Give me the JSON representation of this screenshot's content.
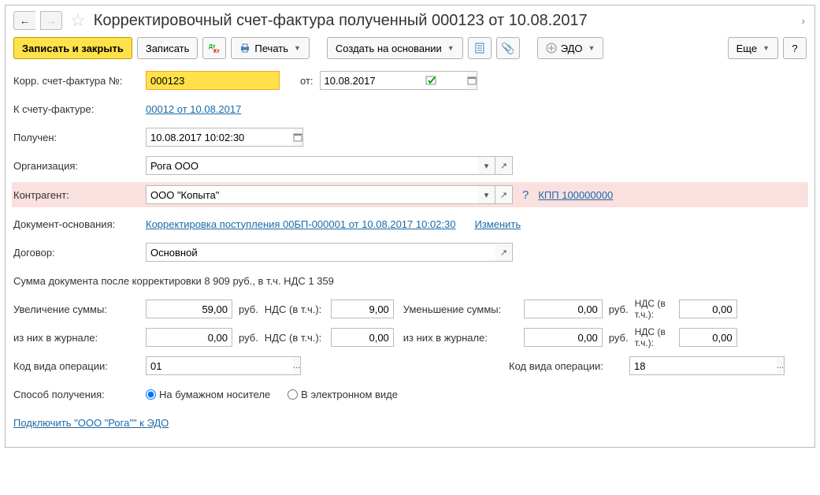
{
  "title": "Корректировочный счет-фактура полученный 000123 от 10.08.2017",
  "toolbar": {
    "save_close": "Записать и закрыть",
    "save": "Записать",
    "print": "Печать",
    "create_based": "Создать на основании",
    "edo": "ЭДО",
    "more": "Еще",
    "help": "?"
  },
  "fields": {
    "number_label": "Корр. счет-фактура №:",
    "number_value": "000123",
    "from_label": "от:",
    "date_value": "10.08.2017",
    "invoice_label": "К счету-фактуре:",
    "invoice_link": "00012 от 10.08.2017",
    "received_label": "Получен:",
    "received_value": "10.08.2017 10:02:30",
    "org_label": "Организация:",
    "org_value": "Рога ООО",
    "counterparty_label": "Контрагент:",
    "counterparty_value": "ООО \"Копыта\"",
    "kpp_link": "КПП 100000000",
    "basis_label": "Документ-основания:",
    "basis_link": "Корректировка поступления 00БП-000001 от 10.08.2017 10:02:30",
    "change_link": "Изменить",
    "contract_label": "Договор:",
    "contract_value": "Основной",
    "summary": "Сумма документа после корректировки 8 909 руб., в т.ч. НДС 1 359",
    "inc_label": "Увеличение суммы:",
    "inc_value": "59,00",
    "rub": "руб.",
    "nds_label": "НДС (в т.ч.):",
    "inc_nds": "9,00",
    "dec_label": "Уменьшение суммы:",
    "dec_value": "0,00",
    "dec_nds": "0,00",
    "journal_label": "из них в журнале:",
    "journal_inc": "0,00",
    "journal_inc_nds": "0,00",
    "journal_dec": "0,00",
    "journal_dec_nds": "0,00",
    "op_code_label": "Код вида операции:",
    "op_code_left": "01",
    "op_code_right": "18",
    "method_label": "Способ получения:",
    "radio_paper": "На бумажном носителе",
    "radio_electronic": "В электронном виде",
    "edo_link": "Подключить \"ООО \"Рога\"\" к ЭДО"
  }
}
